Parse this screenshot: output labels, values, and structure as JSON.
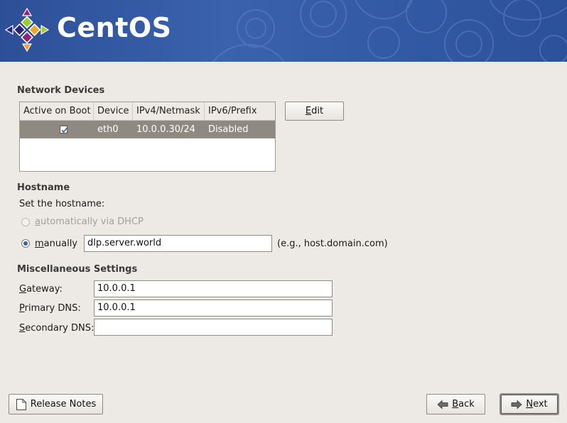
{
  "banner": {
    "brand": "CentOS"
  },
  "network_devices": {
    "title": "Network Devices",
    "columns": [
      "Active on Boot",
      "Device",
      "IPv4/Netmask",
      "IPv6/Prefix"
    ],
    "rows": [
      {
        "active_on_boot": true,
        "device": "eth0",
        "ipv4": "10.0.0.30/24",
        "ipv6": "Disabled"
      }
    ],
    "edit_label": "Edit"
  },
  "hostname": {
    "title": "Hostname",
    "prompt": "Set the hostname:",
    "auto_label": "automatically via DHCP",
    "manual_label": "manually",
    "manual_value": "dlp.server.world",
    "hint": "(e.g., host.domain.com)",
    "selected": "manually"
  },
  "misc": {
    "title": "Miscellaneous Settings",
    "gateway_label": "Gateway:",
    "gateway_value": "10.0.0.1",
    "primary_dns_label": "Primary DNS:",
    "primary_dns_value": "10.0.0.1",
    "secondary_dns_label": "Secondary DNS:",
    "secondary_dns_value": ""
  },
  "footer": {
    "release_notes_label": "Release Notes",
    "back_label": "Back",
    "next_label": "Next"
  },
  "icons": {
    "logo": "centos-logo-icon",
    "check": "check-icon",
    "document": "document-icon",
    "back": "arrow-left-icon",
    "next": "arrow-right-icon"
  },
  "colors": {
    "banner": "#2d4f98",
    "background": "#edeae5",
    "selected_row": "#8f8a81"
  }
}
